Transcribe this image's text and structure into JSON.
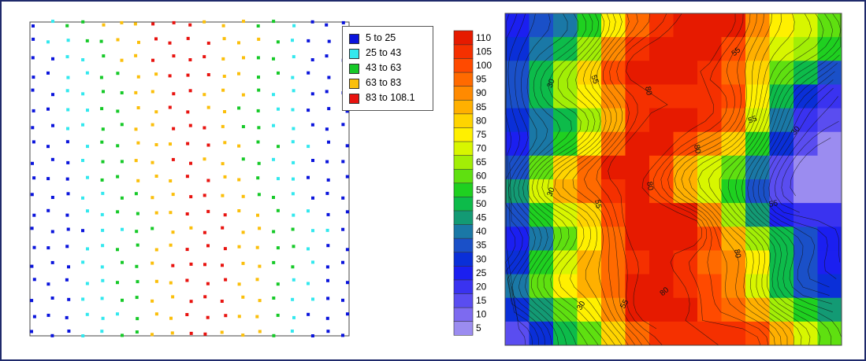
{
  "chart_data": [
    {
      "type": "scatter",
      "title": "",
      "xlabel": "",
      "ylabel": "",
      "grid": false,
      "legend_position": "top-right",
      "legend": [
        {
          "label": "5  to  25",
          "color": "#0a14dc"
        },
        {
          "label": "25  to  43",
          "color": "#33e8ee"
        },
        {
          "label": "43  to  63",
          "color": "#16c928"
        },
        {
          "label": "63  to  83",
          "color": "#fbbf0b"
        },
        {
          "label": "83  to  108.1",
          "color": "#e8130f"
        }
      ],
      "rows": [
        [
          1,
          2,
          3,
          3,
          4,
          4,
          4,
          5,
          5,
          5,
          4,
          4,
          4,
          3,
          3,
          2,
          1,
          1,
          1
        ],
        [
          1,
          2,
          2,
          3,
          3,
          4,
          4,
          5,
          5,
          5,
          5,
          4,
          4,
          4,
          3,
          2,
          1,
          1,
          1
        ],
        [
          1,
          1,
          2,
          2,
          3,
          4,
          4,
          5,
          5,
          5,
          5,
          4,
          4,
          3,
          3,
          2,
          1,
          1,
          1
        ],
        [
          1,
          1,
          2,
          2,
          3,
          3,
          4,
          4,
          5,
          5,
          5,
          4,
          4,
          3,
          3,
          2,
          1,
          1,
          1
        ],
        [
          1,
          1,
          2,
          2,
          3,
          3,
          4,
          4,
          5,
          5,
          4,
          4,
          4,
          3,
          2,
          2,
          1,
          1,
          1
        ],
        [
          1,
          1,
          2,
          2,
          3,
          3,
          4,
          4,
          5,
          5,
          4,
          4,
          3,
          3,
          2,
          2,
          1,
          1,
          1
        ],
        [
          1,
          1,
          2,
          2,
          3,
          3,
          4,
          4,
          5,
          5,
          5,
          4,
          3,
          3,
          2,
          2,
          1,
          1,
          1
        ],
        [
          1,
          1,
          1,
          2,
          3,
          3,
          4,
          4,
          4,
          5,
          5,
          4,
          4,
          3,
          3,
          2,
          2,
          1,
          1
        ],
        [
          1,
          1,
          1,
          2,
          3,
          3,
          4,
          4,
          5,
          5,
          4,
          4,
          3,
          3,
          2,
          2,
          1,
          1,
          1
        ],
        [
          1,
          1,
          1,
          2,
          3,
          3,
          4,
          4,
          4,
          5,
          5,
          4,
          4,
          3,
          2,
          2,
          1,
          1,
          1
        ],
        [
          1,
          1,
          1,
          2,
          2,
          3,
          3,
          4,
          4,
          5,
          5,
          4,
          4,
          3,
          3,
          2,
          1,
          1,
          1
        ],
        [
          1,
          1,
          1,
          2,
          2,
          3,
          3,
          4,
          4,
          5,
          5,
          5,
          4,
          4,
          3,
          2,
          2,
          1,
          1
        ],
        [
          1,
          1,
          1,
          1,
          2,
          2,
          3,
          3,
          4,
          4,
          5,
          5,
          4,
          4,
          3,
          3,
          2,
          2,
          1
        ],
        [
          1,
          1,
          1,
          2,
          2,
          3,
          3,
          4,
          4,
          5,
          5,
          5,
          4,
          4,
          3,
          3,
          2,
          1,
          1
        ],
        [
          1,
          1,
          1,
          2,
          2,
          3,
          3,
          4,
          5,
          5,
          5,
          5,
          4,
          4,
          3,
          3,
          2,
          1,
          1
        ],
        [
          1,
          1,
          1,
          2,
          2,
          3,
          3,
          4,
          4,
          5,
          5,
          5,
          4,
          4,
          3,
          2,
          2,
          1,
          1
        ],
        [
          1,
          1,
          1,
          2,
          2,
          3,
          3,
          4,
          4,
          5,
          5,
          5,
          4,
          4,
          3,
          2,
          2,
          1,
          1
        ],
        [
          1,
          1,
          1,
          2,
          2,
          2,
          3,
          4,
          4,
          5,
          5,
          5,
          4,
          4,
          3,
          2,
          1,
          1,
          1
        ],
        [
          1,
          1,
          1,
          2,
          2,
          3,
          3,
          4,
          4,
          5,
          5,
          4,
          4,
          4,
          3,
          2,
          1,
          1,
          1
        ]
      ]
    },
    {
      "type": "heatmap",
      "subtype": "filled-contour",
      "title": "",
      "colorbar": {
        "min": 5,
        "max": 115,
        "step": 5,
        "tick_labels": [
          "110",
          "105",
          "100",
          "95",
          "90",
          "85",
          "80",
          "75",
          "70",
          "65",
          "60",
          "55",
          "50",
          "45",
          "40",
          "35",
          "30",
          "25",
          "20",
          "15",
          "10",
          "5"
        ],
        "colors": [
          "#9b8cf0",
          "#7d6af0",
          "#5a4df0",
          "#3a33f0",
          "#1b1ff0",
          "#0a2fd8",
          "#1a50c8",
          "#1a78a6",
          "#139a74",
          "#0dbb4a",
          "#1fd020",
          "#5fe010",
          "#a2ee06",
          "#d8f600",
          "#fff000",
          "#ffd400",
          "#ffb000",
          "#ff8a00",
          "#ff6a00",
          "#ff4a00",
          "#f53000",
          "#e61a00"
        ]
      },
      "contour_labels": [
        "30",
        "30",
        "30",
        "30",
        "55",
        "55",
        "55",
        "55",
        "55",
        "55",
        "80",
        "80",
        "80",
        "80",
        "80"
      ]
    }
  ]
}
